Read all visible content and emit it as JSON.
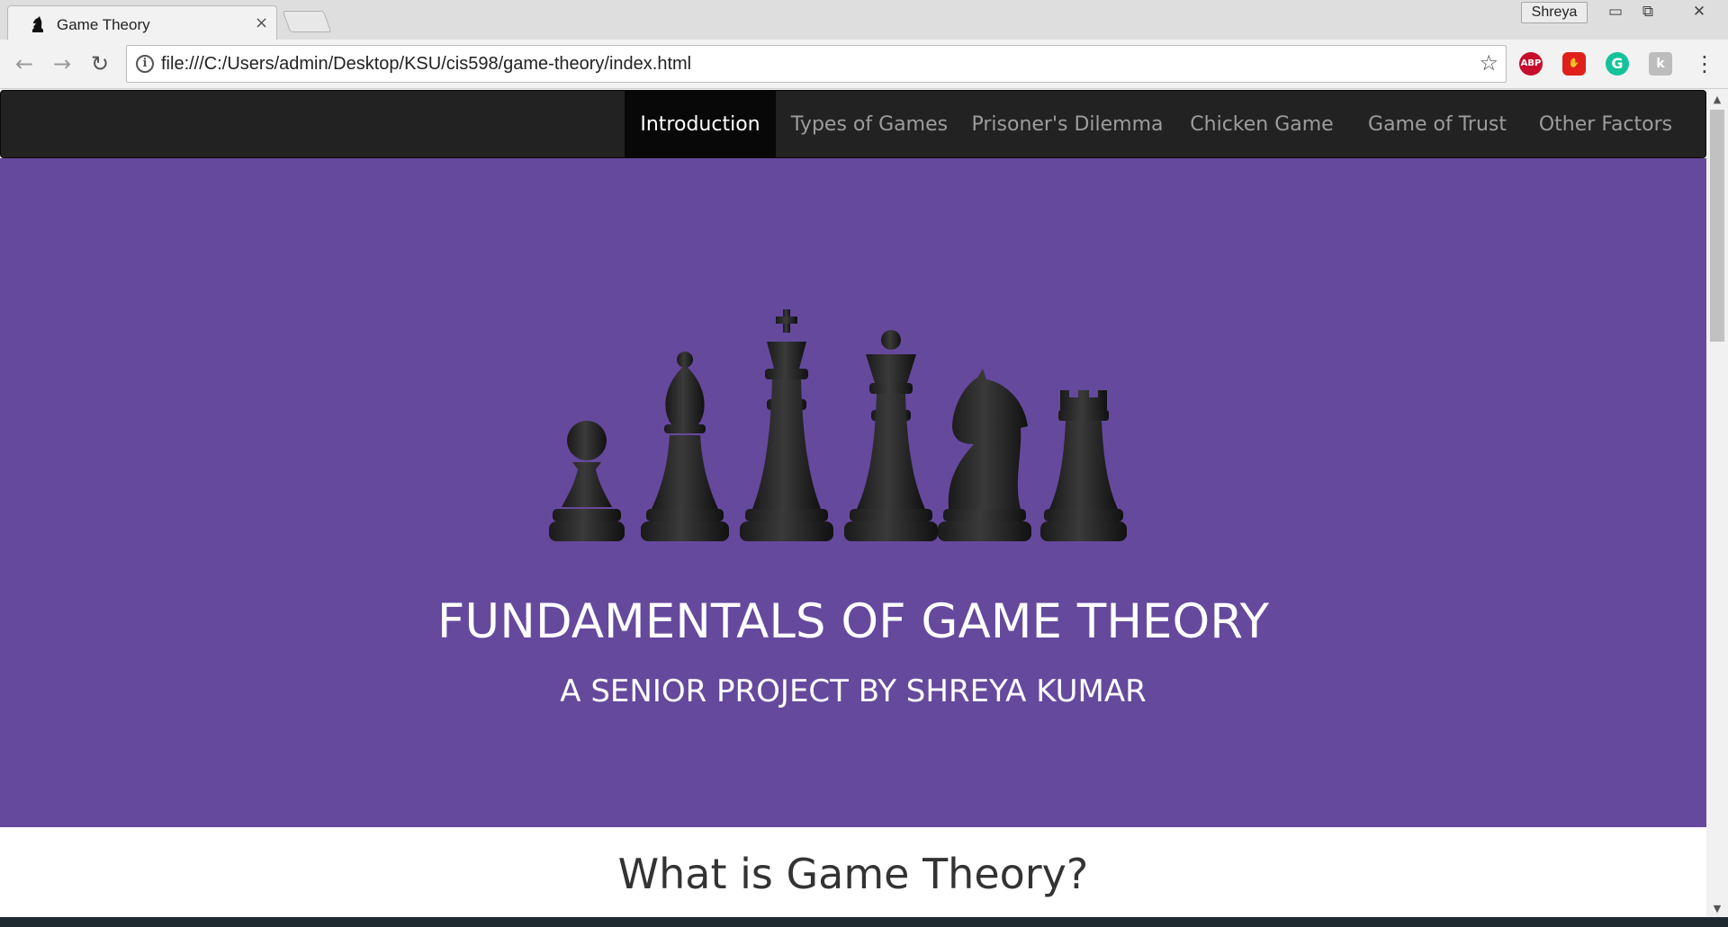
{
  "browser": {
    "tab_title": "Game Theory",
    "tab_close": "×",
    "profile_name": "Shreya",
    "window_minimize": "▭",
    "window_restore": "⧉",
    "window_close": "✕",
    "url": "file:///C:/Users/admin/Desktop/KSU/cis598/game-theory/index.html",
    "info_icon": "i",
    "bookmark_icon": "☆",
    "back_icon": "←",
    "forward_icon": "→",
    "reload_icon": "↻",
    "menu_icon": "⋮",
    "extensions": [
      {
        "name": "adblock-plus",
        "label": "ABP"
      },
      {
        "name": "stop-extension",
        "label": "✋"
      },
      {
        "name": "grammarly",
        "label": "G"
      },
      {
        "name": "extension-k",
        "label": "k"
      }
    ]
  },
  "navbar": {
    "items": [
      {
        "label": "Introduction",
        "active": true
      },
      {
        "label": "Types of Games",
        "active": false
      },
      {
        "label": "Prisoner's Dilemma",
        "active": false
      },
      {
        "label": "Chicken Game",
        "active": false
      },
      {
        "label": "Game of Trust",
        "active": false
      },
      {
        "label": "Other Factors",
        "active": false
      }
    ]
  },
  "hero": {
    "title": "FUNDAMENTALS OF GAME THEORY",
    "subtitle": "A SENIOR PROJECT BY SHREYA KUMAR",
    "background_color": "#65499d",
    "image_icons": [
      "pawn-icon",
      "bishop-icon",
      "king-icon",
      "queen-icon",
      "knight-icon",
      "rook-icon"
    ]
  },
  "section": {
    "title": "What is Game Theory?"
  },
  "scrollbar": {
    "up": "▲",
    "down": "▼"
  }
}
